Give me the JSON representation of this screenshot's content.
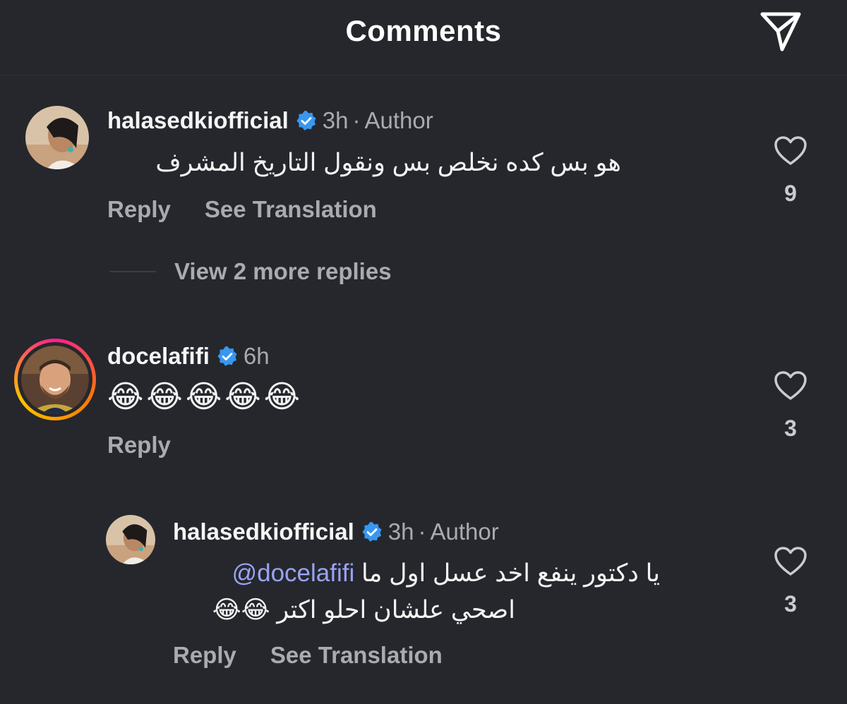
{
  "header": {
    "title": "Comments",
    "share_icon": "paper-plane-icon"
  },
  "comments": [
    {
      "username": "halasedkiofficial",
      "verified": true,
      "time": "3h",
      "separator": "·",
      "author_tag": "Author",
      "text": "هو بس كده  نخلص بس ونقول التاريخ المشرف",
      "reply_label": "Reply",
      "translate_label": "See Translation",
      "like_count": "9",
      "view_more_replies": "View 2 more replies"
    },
    {
      "username": "docelafifi",
      "verified": true,
      "time": "6h",
      "text": "😂😂😂😂😂",
      "reply_label": "Reply",
      "like_count": "3",
      "has_story_ring": true
    },
    {
      "username": "halasedkiofficial",
      "verified": true,
      "time": "3h",
      "separator": "·",
      "author_tag": "Author",
      "mention": "@docelafifi",
      "text_line1": "يا دكتور ينفع اخد عسل اول ما",
      "text_line2": "اصحي علشان احلو اكتر 😂😂",
      "reply_label": "Reply",
      "translate_label": "See Translation",
      "like_count": "3"
    }
  ],
  "colors": {
    "background": "#25272c",
    "secondary_text": "#a8abb2",
    "mention": "#9aa3f5",
    "verified_badge": "#3897f0"
  }
}
